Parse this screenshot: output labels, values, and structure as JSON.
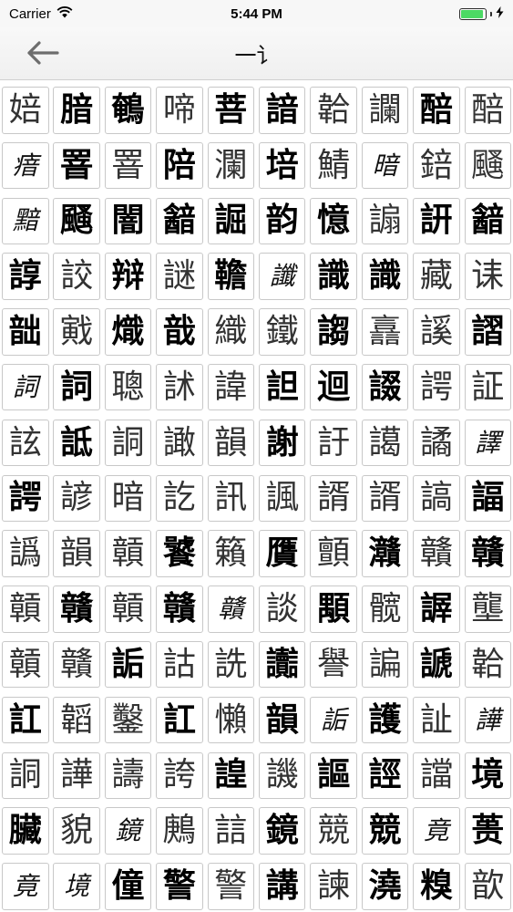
{
  "status": {
    "carrier": "Carrier",
    "time": "5:44 PM",
    "battery_level": 0.92,
    "battery_color": "#4cd964"
  },
  "nav": {
    "title": "一讠",
    "back_icon": "arrow-left-icon"
  },
  "grid": [
    {
      "c": "婄",
      "s": "light"
    },
    {
      "c": "腤",
      "s": "bold"
    },
    {
      "c": "鵪",
      "s": "bold"
    },
    {
      "c": "啼",
      "s": "light"
    },
    {
      "c": "菩",
      "s": "bold"
    },
    {
      "c": "諳",
      "s": "bold"
    },
    {
      "c": "韐",
      "s": "light"
    },
    {
      "c": "讕",
      "s": "light"
    },
    {
      "c": "醅",
      "s": "bold"
    },
    {
      "c": "醅",
      "s": "light"
    },
    {
      "c": "瘖",
      "s": "seal"
    },
    {
      "c": "罯",
      "s": "bold"
    },
    {
      "c": "罯",
      "s": "light"
    },
    {
      "c": "陪",
      "s": "bold"
    },
    {
      "c": "瀾",
      "s": "light"
    },
    {
      "c": "培",
      "s": "bold"
    },
    {
      "c": "鯖",
      "s": "light"
    },
    {
      "c": "暗",
      "s": "seal"
    },
    {
      "c": "錇",
      "s": "light"
    },
    {
      "c": "颾",
      "s": "light"
    },
    {
      "c": "黯",
      "s": "seal"
    },
    {
      "c": "颾",
      "s": "bold"
    },
    {
      "c": "闇",
      "s": "bold"
    },
    {
      "c": "韽",
      "s": "bold"
    },
    {
      "c": "誳",
      "s": "bold"
    },
    {
      "c": "韵",
      "s": "bold"
    },
    {
      "c": "憶",
      "s": "bold"
    },
    {
      "c": "謆",
      "s": "light"
    },
    {
      "c": "詽",
      "s": "bold"
    },
    {
      "c": "韽",
      "s": "bold"
    },
    {
      "c": "諄",
      "s": "bold"
    },
    {
      "c": "詨",
      "s": "light"
    },
    {
      "c": "辩",
      "s": "bold"
    },
    {
      "c": "謎",
      "s": "light"
    },
    {
      "c": "韂",
      "s": "bold"
    },
    {
      "c": "讖",
      "s": "seal"
    },
    {
      "c": "識",
      "s": "bold"
    },
    {
      "c": "識",
      "s": "bold"
    },
    {
      "c": "藏",
      "s": "light"
    },
    {
      "c": "诔",
      "s": "light"
    },
    {
      "c": "韷",
      "s": "bold"
    },
    {
      "c": "戭",
      "s": "light"
    },
    {
      "c": "熾",
      "s": "bold"
    },
    {
      "c": "戠",
      "s": "bold"
    },
    {
      "c": "織",
      "s": "light"
    },
    {
      "c": "鐵",
      "s": "light"
    },
    {
      "c": "謅",
      "s": "bold"
    },
    {
      "c": "譶",
      "s": "light"
    },
    {
      "c": "謑",
      "s": "light"
    },
    {
      "c": "謵",
      "s": "bold"
    },
    {
      "c": "詞",
      "s": "seal"
    },
    {
      "c": "詞",
      "s": "bold"
    },
    {
      "c": "聰",
      "s": "light"
    },
    {
      "c": "訹",
      "s": "light"
    },
    {
      "c": "諱",
      "s": "light"
    },
    {
      "c": "詚",
      "s": "bold"
    },
    {
      "c": "迴",
      "s": "bold"
    },
    {
      "c": "諁",
      "s": "bold"
    },
    {
      "c": "諤",
      "s": "light"
    },
    {
      "c": "証",
      "s": "light"
    },
    {
      "c": "詃",
      "s": "light"
    },
    {
      "c": "詆",
      "s": "bold"
    },
    {
      "c": "詷",
      "s": "light"
    },
    {
      "c": "譀",
      "s": "light"
    },
    {
      "c": "韻",
      "s": "light"
    },
    {
      "c": "謝",
      "s": "bold"
    },
    {
      "c": "訏",
      "s": "light"
    },
    {
      "c": "譪",
      "s": "light"
    },
    {
      "c": "譎",
      "s": "light"
    },
    {
      "c": "譯",
      "s": "seal"
    },
    {
      "c": "諤",
      "s": "bold"
    },
    {
      "c": "諺",
      "s": "light"
    },
    {
      "c": "暗",
      "s": "light"
    },
    {
      "c": "訖",
      "s": "light"
    },
    {
      "c": "訊",
      "s": "light"
    },
    {
      "c": "諷",
      "s": "light"
    },
    {
      "c": "諝",
      "s": "light"
    },
    {
      "c": "諝",
      "s": "light"
    },
    {
      "c": "謞",
      "s": "light"
    },
    {
      "c": "諨",
      "s": "bold"
    },
    {
      "c": "譌",
      "s": "light"
    },
    {
      "c": "韻",
      "s": "light"
    },
    {
      "c": "贑",
      "s": "light"
    },
    {
      "c": "饕",
      "s": "bold"
    },
    {
      "c": "籟",
      "s": "light"
    },
    {
      "c": "贋",
      "s": "bold"
    },
    {
      "c": "顫",
      "s": "light"
    },
    {
      "c": "灨",
      "s": "bold"
    },
    {
      "c": "贛",
      "s": "light"
    },
    {
      "c": "贛",
      "s": "bold"
    },
    {
      "c": "贑",
      "s": "light"
    },
    {
      "c": "贛",
      "s": "bold"
    },
    {
      "c": "贑",
      "s": "light"
    },
    {
      "c": "贛",
      "s": "bold"
    },
    {
      "c": "贛",
      "s": "seal"
    },
    {
      "c": "談",
      "s": "light"
    },
    {
      "c": "顒",
      "s": "bold"
    },
    {
      "c": "髋",
      "s": "light"
    },
    {
      "c": "謘",
      "s": "bold"
    },
    {
      "c": "壟",
      "s": "light"
    },
    {
      "c": "贑",
      "s": "light"
    },
    {
      "c": "贛",
      "s": "light"
    },
    {
      "c": "詬",
      "s": "bold"
    },
    {
      "c": "詁",
      "s": "light"
    },
    {
      "c": "詵",
      "s": "light"
    },
    {
      "c": "讟",
      "s": "bold"
    },
    {
      "c": "譽",
      "s": "light"
    },
    {
      "c": "諞",
      "s": "light"
    },
    {
      "c": "謕",
      "s": "bold"
    },
    {
      "c": "韐",
      "s": "light"
    },
    {
      "c": "訌",
      "s": "bold"
    },
    {
      "c": "韜",
      "s": "light"
    },
    {
      "c": "鑿",
      "s": "light"
    },
    {
      "c": "訌",
      "s": "bold"
    },
    {
      "c": "懶",
      "s": "light"
    },
    {
      "c": "韻",
      "s": "bold"
    },
    {
      "c": "詬",
      "s": "seal"
    },
    {
      "c": "護",
      "s": "bold"
    },
    {
      "c": "訨",
      "s": "light"
    },
    {
      "c": "譁",
      "s": "seal"
    },
    {
      "c": "詷",
      "s": "light"
    },
    {
      "c": "譁",
      "s": "light"
    },
    {
      "c": "譸",
      "s": "light"
    },
    {
      "c": "誇",
      "s": "light"
    },
    {
      "c": "諻",
      "s": "bold"
    },
    {
      "c": "譏",
      "s": "light"
    },
    {
      "c": "謳",
      "s": "bold"
    },
    {
      "c": "誙",
      "s": "bold"
    },
    {
      "c": "譡",
      "s": "light"
    },
    {
      "c": "境",
      "s": "bold"
    },
    {
      "c": "臟",
      "s": "bold"
    },
    {
      "c": "貌",
      "s": "light"
    },
    {
      "c": "鏡",
      "s": "seal"
    },
    {
      "c": "鶊",
      "s": "light"
    },
    {
      "c": "誩",
      "s": "light"
    },
    {
      "c": "鏡",
      "s": "bold"
    },
    {
      "c": "競",
      "s": "light"
    },
    {
      "c": "競",
      "s": "bold"
    },
    {
      "c": "竟",
      "s": "seal"
    },
    {
      "c": "蒉",
      "s": "bold"
    },
    {
      "c": "竟",
      "s": "seal"
    },
    {
      "c": "境",
      "s": "seal"
    },
    {
      "c": "僮",
      "s": "bold"
    },
    {
      "c": "警",
      "s": "bold"
    },
    {
      "c": "警",
      "s": "light"
    },
    {
      "c": "講",
      "s": "bold"
    },
    {
      "c": "諫",
      "s": "light"
    },
    {
      "c": "澆",
      "s": "bold"
    },
    {
      "c": "糗",
      "s": "bold"
    },
    {
      "c": "歆",
      "s": "light"
    }
  ]
}
